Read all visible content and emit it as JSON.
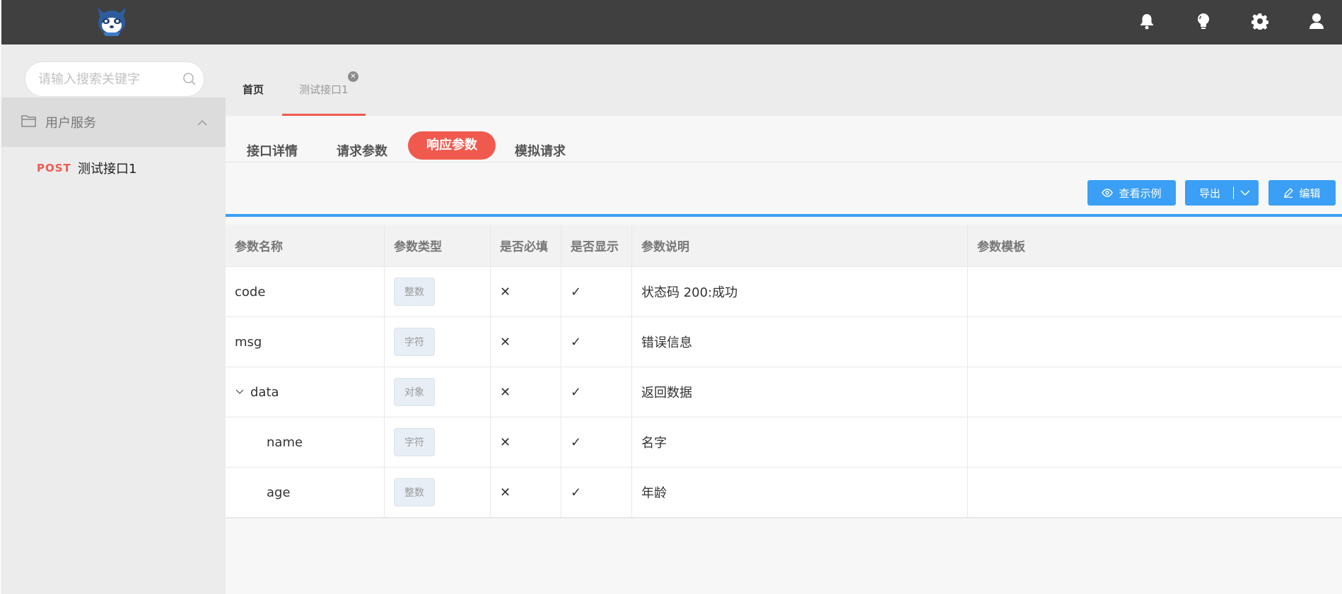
{
  "header": {
    "icons": [
      "bell-icon",
      "lightbulb-icon",
      "gear-icon",
      "user-icon"
    ]
  },
  "sidebar": {
    "search_placeholder": "请输入搜索关键字",
    "group_label": "用户服务",
    "items": [
      {
        "method": "POST",
        "name": "测试接口1"
      }
    ]
  },
  "page_tabs": {
    "home": "首页",
    "active": "测试接口1"
  },
  "sub_tabs": [
    "接口详情",
    "请求参数",
    "响应参数",
    "模拟请求"
  ],
  "active_sub_tab": "响应参数",
  "toolbar": {
    "view_example": "查看示例",
    "export": "导出",
    "edit": "编辑"
  },
  "table": {
    "columns": [
      "参数名称",
      "参数类型",
      "是否必填",
      "是否显示",
      "参数说明",
      "参数模板"
    ],
    "rows": [
      {
        "name": "code",
        "type": "整数",
        "required": "✕",
        "visible": "✓",
        "desc": "状态码 200:成功",
        "template": ""
      },
      {
        "name": "msg",
        "type": "字符",
        "required": "✕",
        "visible": "✓",
        "desc": "错误信息",
        "template": ""
      },
      {
        "name": "data",
        "type": "对象",
        "required": "✕",
        "visible": "✓",
        "desc": "返回数据",
        "template": ""
      },
      {
        "name": "name",
        "type": "字符",
        "required": "✕",
        "visible": "✓",
        "desc": "名字",
        "template": ""
      },
      {
        "name": "age",
        "type": "整数",
        "required": "✕",
        "visible": "✓",
        "desc": "年龄",
        "template": ""
      }
    ]
  },
  "colors": {
    "accent": "#f05a4e",
    "primary": "#3a9ff5",
    "topbar": "#404040"
  }
}
